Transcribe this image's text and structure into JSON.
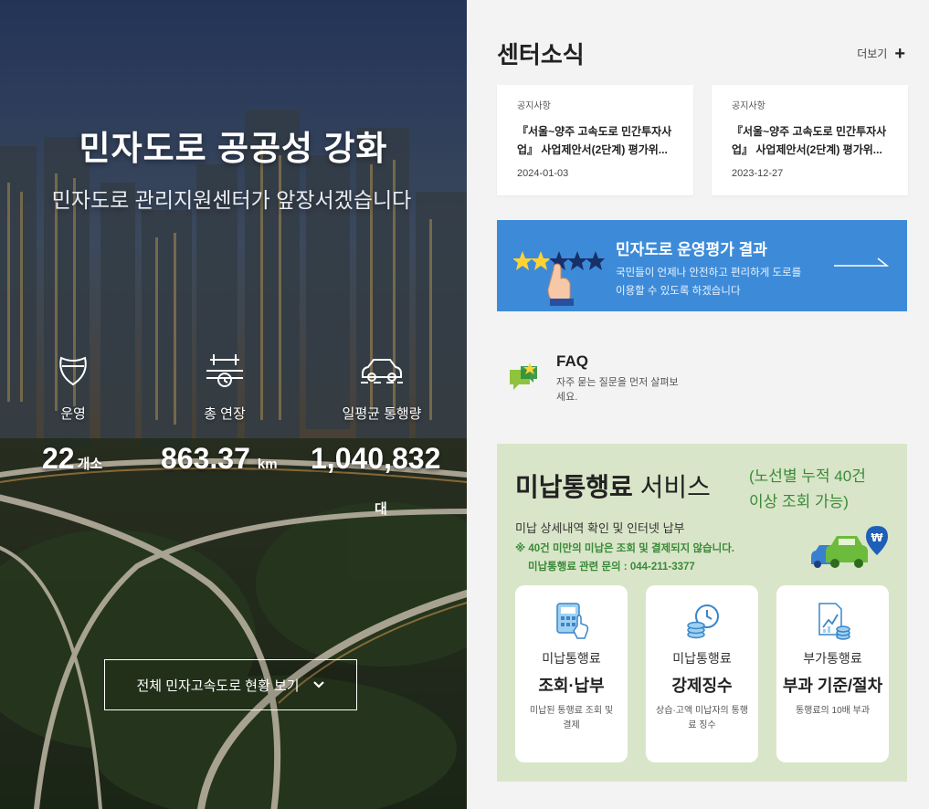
{
  "hero": {
    "title": "민자도로 공공성 강화",
    "subtitle": "민자도로 관리지원센터가 앞장서겠습니다",
    "stats": [
      {
        "label": "운영",
        "value": "22",
        "unit": "개소"
      },
      {
        "label": "총 연장",
        "value": "863.37",
        "unit": "km"
      },
      {
        "label": "일평균 통행량",
        "value": "1,040,832",
        "unit": "대"
      }
    ],
    "button_label": "전체 민자고속도로 현황 보기"
  },
  "news": {
    "title": "센터소식",
    "more_label": "더보기",
    "items": [
      {
        "category": "공지사항",
        "title": "『서울~양주 고속도로 민간투자사업』 사업제안서(2단계) 평가위...",
        "date": "2024-01-03"
      },
      {
        "category": "공지사항",
        "title": "『서울~양주 고속도로 민간투자사업』 사업제안서(2단계) 평가위...",
        "date": "2023-12-27"
      }
    ]
  },
  "evaluation": {
    "title": "민자도로 운영평가 결과",
    "desc_line1": "국민들이 언제나 안전하고 편리하게 도로를",
    "desc_line2": "이용할 수 있도록 하겠습니다"
  },
  "faq": {
    "title": "FAQ",
    "desc": "자주 묻는 질문을 먼저 살펴보세요."
  },
  "unpaid": {
    "title_bold": "미납통행료",
    "title_rest": " 서비스",
    "note_line1": "(노선별 누적 40건",
    "note_line2": "이상 조회 가능)",
    "desc": "미납 상세내역 확인 및 인터넷 납부",
    "warn_line1": "※ 40건 미만의 미납은 조회 및 결제되지 않습니다.",
    "warn_line2": "미납통행료 관련 문의 : 044-211-3377",
    "cards": [
      {
        "top": "미납통행료",
        "main": "조회·납부",
        "desc": "미납된 통행료 조회 및 결제"
      },
      {
        "top": "미납통행료",
        "main": "강제징수",
        "desc": "상습·고액 미납자의 통행료 징수"
      },
      {
        "top": "부가통행료",
        "main": "부과 기준/절차",
        "desc": "통행료의 10배 부과"
      }
    ]
  },
  "colors": {
    "eval_bg": "#3d8bd8",
    "unpaid_bg": "#d9e5c8",
    "accent_green": "#3a8a3a"
  }
}
